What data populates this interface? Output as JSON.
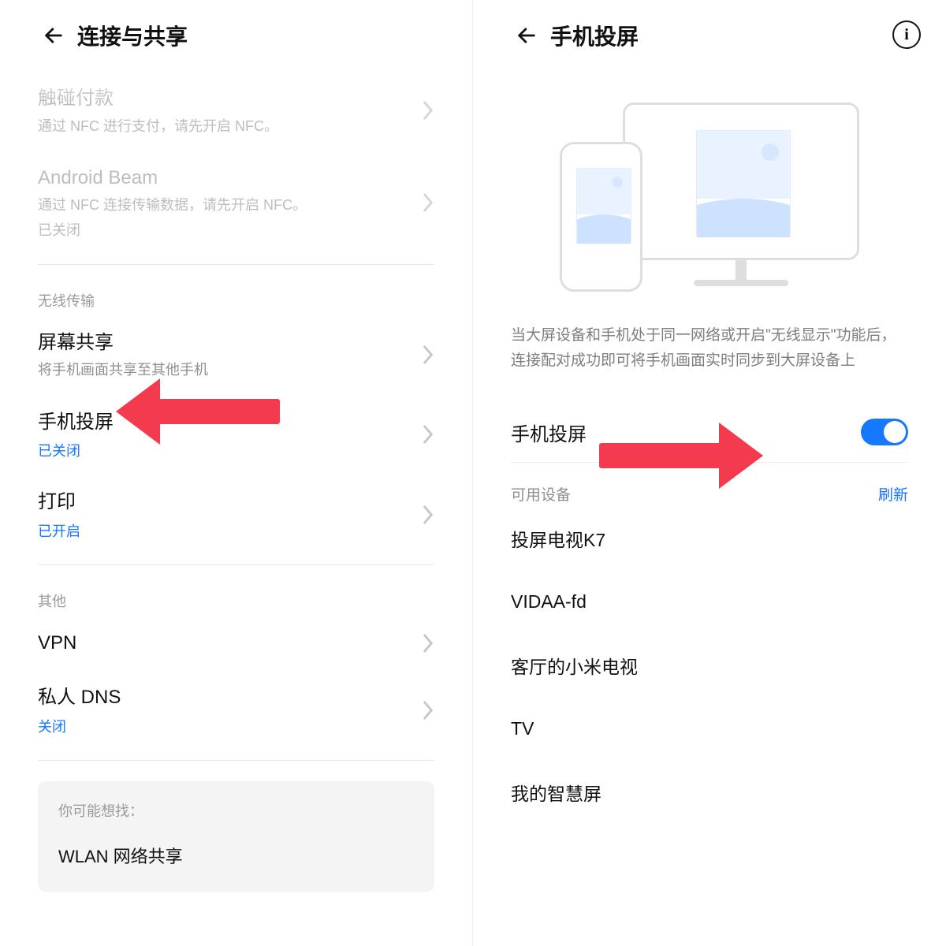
{
  "left": {
    "title": "连接与共享",
    "items": {
      "tap_pay": {
        "title": "触碰付款",
        "sub": "通过 NFC 进行支付，请先开启 NFC。"
      },
      "beam": {
        "title": "Android Beam",
        "sub": "通过 NFC 连接传输数据，请先开启 NFC。",
        "status_sub": "已关闭"
      },
      "section_wireless": "无线传输",
      "screen_share": {
        "title": "屏幕共享",
        "sub": "将手机画面共享至其他手机"
      },
      "cast": {
        "title": "手机投屏",
        "status": "已关闭"
      },
      "print": {
        "title": "打印",
        "status": "已开启"
      },
      "section_other": "其他",
      "vpn": {
        "title": "VPN"
      },
      "dns": {
        "title": "私人 DNS",
        "status": "关闭"
      }
    },
    "suggest": {
      "hint": "你可能想找：",
      "item": "WLAN 网络共享"
    }
  },
  "right": {
    "title": "手机投屏",
    "desc": "当大屏设备和手机处于同一网络或开启\"无线显示\"功能后，连接配对成功即可将手机画面实时同步到大屏设备上",
    "toggle_label": "手机投屏",
    "toggle_on": true,
    "devices_label": "可用设备",
    "refresh": "刷新",
    "devices": [
      "投屏电视K7",
      "VIDAA-fd",
      "客厅的小米电视",
      "TV",
      "我的智慧屏"
    ]
  }
}
